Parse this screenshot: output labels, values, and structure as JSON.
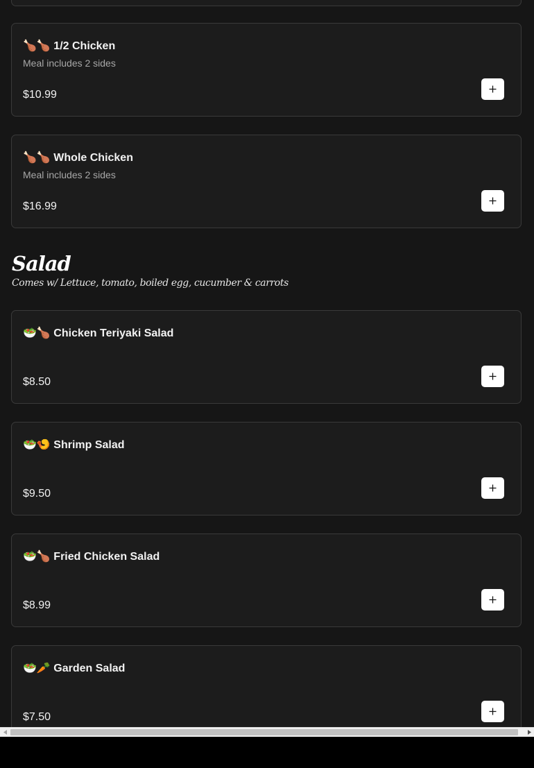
{
  "chicken_items": [
    {
      "emoji": "🍗🍗",
      "name": "1/2 Chicken",
      "description": "Meal includes 2 sides",
      "price": "$10.99"
    },
    {
      "emoji": "🍗🍗",
      "name": "Whole Chicken",
      "description": "Meal includes 2 sides",
      "price": "$16.99"
    }
  ],
  "salad_section": {
    "title": "Salad",
    "subtitle": "Comes w/ Lettuce, tomato, boiled egg, cucumber & carrots"
  },
  "salad_items": [
    {
      "emoji": "🥗🍗",
      "name": "Chicken Teriyaki Salad",
      "price": "$8.50"
    },
    {
      "emoji": "🥗🍤",
      "name": "Shrimp Salad",
      "price": "$9.50"
    },
    {
      "emoji": "🥗🍗",
      "name": "Fried Chicken Salad",
      "price": "$8.99"
    },
    {
      "emoji": "🥗🥕",
      "name": "Garden Salad",
      "price": "$7.50"
    }
  ],
  "icons": {
    "add": "plus-icon",
    "scroll_left": "triangle-left-icon",
    "scroll_right": "triangle-right-icon"
  },
  "colors": {
    "background": "#161616",
    "card": "#1c1c1c",
    "card_border": "#3a3a3a",
    "button": "#ffffff"
  }
}
